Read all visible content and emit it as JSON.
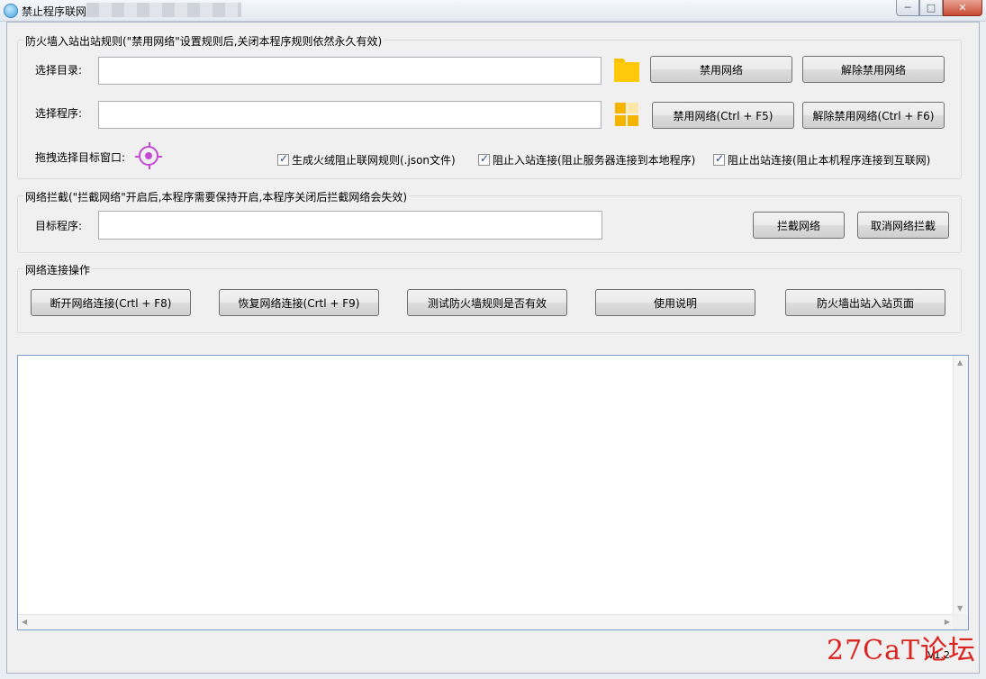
{
  "window": {
    "title": "禁止程序联网",
    "buttons": {
      "minimize": "─",
      "maximize": "□",
      "close": "✕"
    }
  },
  "group_firewall": {
    "title": "防火墙入站出站规则(\"禁用网络\"设置规则后,关闭本程序规则依然永久有效)",
    "select_dir_label": "选择目录:",
    "select_dir_value": "",
    "select_program_label": "选择程序:",
    "select_program_value": "",
    "drag_label": "拖拽选择目标窗口:",
    "btn_disable": "禁用网络",
    "btn_enable": "解除禁用网络",
    "btn_disable_hotkey": "禁用网络(Ctrl + F5)",
    "btn_enable_hotkey": "解除禁用网络(Ctrl + F6)",
    "chk_json": "生成火绒阻止联网规则(.json文件)",
    "chk_inbound": "阻止入站连接(阻止服务器连接到本地程序)",
    "chk_outbound": "阻止出站连接(阻止本机程序连接到互联网)",
    "chk_json_checked": true,
    "chk_inbound_checked": true,
    "chk_outbound_checked": true
  },
  "group_intercept": {
    "title": "网络拦截(\"拦截网络\"开启后,本程序需要保持开启,本程序关闭后拦截网络会失效)",
    "target_label": "目标程序:",
    "target_value": "",
    "btn_intercept": "拦截网络",
    "btn_cancel_intercept": "取消网络拦截"
  },
  "group_connection": {
    "title": "网络连接操作",
    "btn_disconnect": "断开网络连接(Crtl + F8)",
    "btn_restore": "恢复网络连接(Crtl + F9)",
    "btn_test": "测试防火墙规则是否有效",
    "btn_help": "使用说明",
    "btn_firewall_page": "防火墙出站入站页面"
  },
  "log": {
    "content": ""
  },
  "version": "V1.2",
  "watermark": "27CaT论坛",
  "icons": {
    "app": "app-shield-icon",
    "folder": "folder-icon",
    "program": "program-grid-icon",
    "target": "crosshair-target-icon"
  },
  "colors": {
    "accent_purple": "#c44ad6",
    "folder_yellow": "#ffc80a",
    "watermark_red": "#d9241f"
  }
}
